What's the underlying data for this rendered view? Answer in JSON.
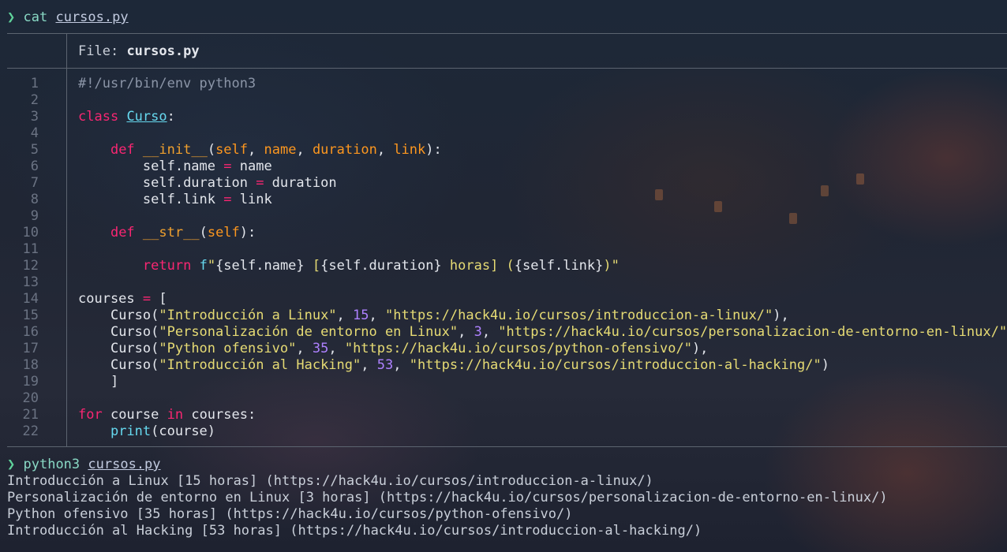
{
  "terminal": {
    "prompt_symbol": "❯",
    "cmd1": {
      "command": "cat",
      "argument": "cursos.py"
    },
    "file_header": {
      "label": "File:",
      "filename": "cursos.py"
    },
    "line_numbers": [
      "1",
      "2",
      "3",
      "4",
      "5",
      "6",
      "7",
      "8",
      "9",
      "10",
      "11",
      "12",
      "13",
      "14",
      "15",
      "16",
      "17",
      "18",
      "19",
      "20",
      "21",
      "22"
    ],
    "code": {
      "l1": "#!/usr/bin/env python3",
      "l3_kw": "class",
      "l3_name": "Curso",
      "l3_colon": ":",
      "l5_kw": "def",
      "l5_fn": "__init__",
      "l5_open": "(",
      "l5_p1": "self",
      "l5_c1": ", ",
      "l5_p2": "name",
      "l5_c2": ", ",
      "l5_p3": "duration",
      "l5_c3": ", ",
      "l5_p4": "link",
      "l5_close": "):",
      "l6_a": "self.name ",
      "l6_op": "=",
      "l6_b": " name",
      "l7_a": "self.duration ",
      "l7_op": "=",
      "l7_b": " duration",
      "l8_a": "self.link ",
      "l8_op": "=",
      "l8_b": " link",
      "l10_kw": "def",
      "l10_fn": "__str__",
      "l10_open": "(",
      "l10_p": "self",
      "l10_close": "):",
      "l12_kw": "return",
      "l12_f": "f",
      "l12_q1": "\"",
      "l12_e1": "{self.name}",
      "l12_s1": " [",
      "l12_e2": "{self.duration}",
      "l12_s2": " horas] (",
      "l12_e3": "{self.link}",
      "l12_s3": ")\"",
      "l14_a": "courses ",
      "l14_op": "=",
      "l14_b": " [",
      "l15_c": "Curso(",
      "l15_s": "\"Introducción a Linux\"",
      "l15_sep1": ", ",
      "l15_n": "15",
      "l15_sep2": ", ",
      "l15_u": "\"https://hack4u.io/cursos/introduccion-a-linux/\"",
      "l15_e": "),",
      "l16_c": "Curso(",
      "l16_s": "\"Personalización de entorno en Linux\"",
      "l16_sep1": ", ",
      "l16_n": "3",
      "l16_sep2": ", ",
      "l16_u": "\"https://hack4u.io/cursos/personalizacion-de-entorno-en-linux/\"",
      "l16_e": "),",
      "l17_c": "Curso(",
      "l17_s": "\"Python ofensivo\"",
      "l17_sep1": ", ",
      "l17_n": "35",
      "l17_sep2": ", ",
      "l17_u": "\"https://hack4u.io/cursos/python-ofensivo/\"",
      "l17_e": "),",
      "l18_c": "Curso(",
      "l18_s": "\"Introducción al Hacking\"",
      "l18_sep1": ", ",
      "l18_n": "53",
      "l18_sep2": ", ",
      "l18_u": "\"https://hack4u.io/cursos/introduccion-al-hacking/\"",
      "l18_e": ")",
      "l19": "]",
      "l21_kw1": "for",
      "l21_a": " course ",
      "l21_kw2": "in",
      "l21_b": " courses:",
      "l22_fn": "print",
      "l22_b": "(course)"
    },
    "cmd2": {
      "command": "python3",
      "argument": "cursos.py"
    },
    "output": [
      "Introducción a Linux [15 horas] (https://hack4u.io/cursos/introduccion-a-linux/)",
      "Personalización de entorno en Linux [3 horas] (https://hack4u.io/cursos/personalizacion-de-entorno-en-linux/)",
      "Python ofensivo [35 horas] (https://hack4u.io/cursos/python-ofensivo/)",
      "Introducción al Hacking [53 horas] (https://hack4u.io/cursos/introduccion-al-hacking/)"
    ]
  }
}
